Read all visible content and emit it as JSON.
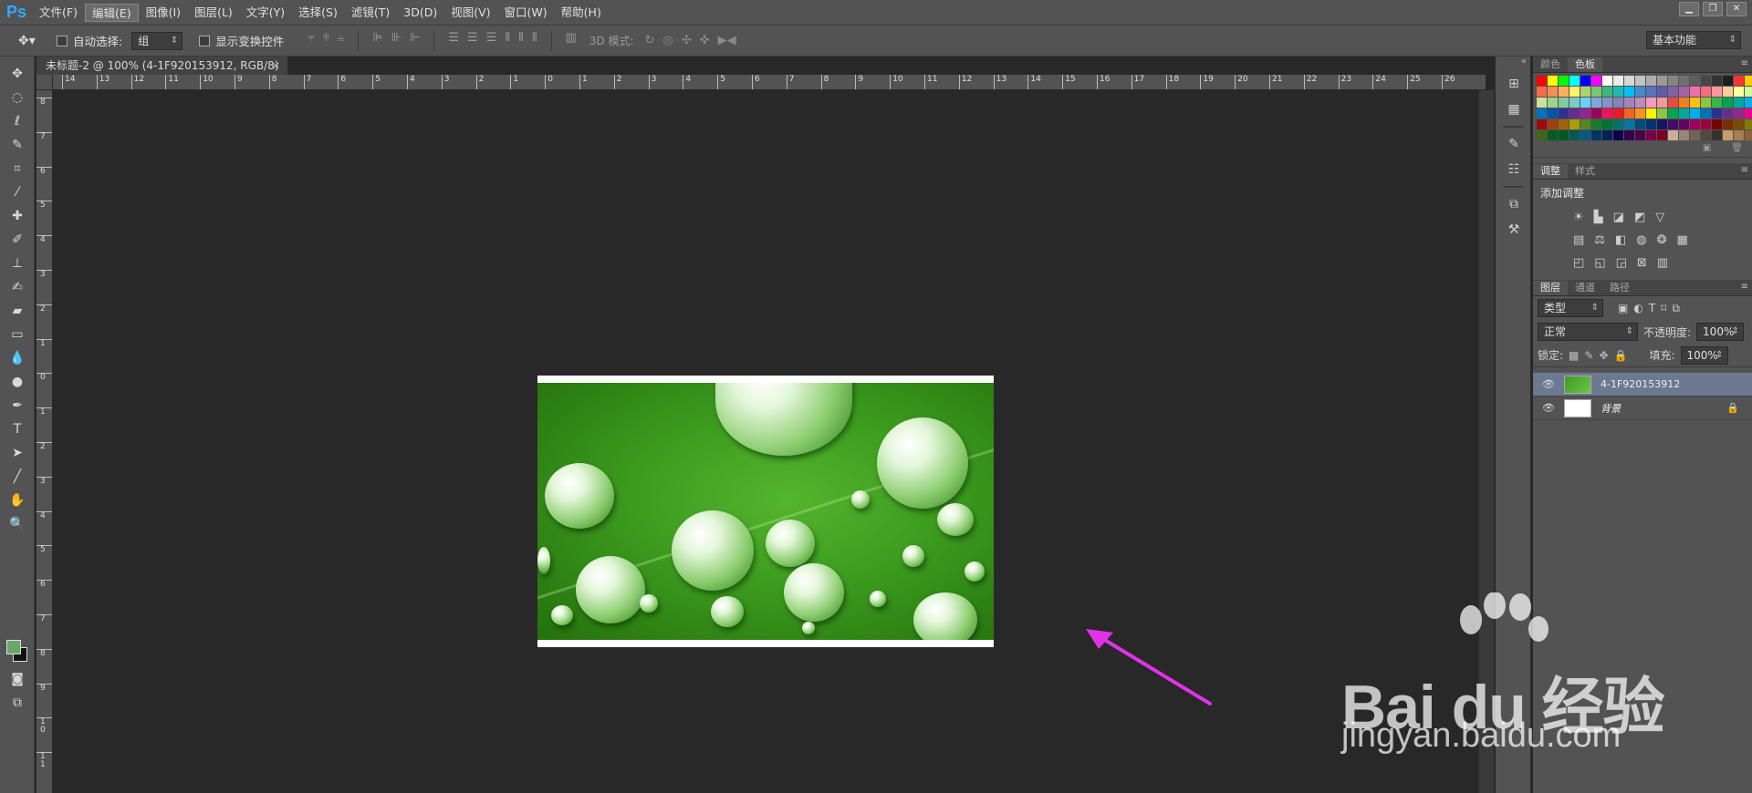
{
  "app": {
    "logo": "Ps"
  },
  "menu": [
    "文件(F)",
    "编辑(E)",
    "图像(I)",
    "图层(L)",
    "文字(Y)",
    "选择(S)",
    "滤镜(T)",
    "3D(D)",
    "视图(V)",
    "窗口(W)",
    "帮助(H)"
  ],
  "menu_active_index": 1,
  "options": {
    "auto_select_label": "自动选择:",
    "auto_select_value": "组",
    "show_transform_label": "显示变换控件",
    "mode_3d_label": "3D 模式:",
    "workspace": "基本功能"
  },
  "document": {
    "tab_title": "未标题-2 @ 100% (4-1F920153912, RGB/8) *",
    "close_glyph": "×"
  },
  "ruler_h": [
    "14",
    "13",
    "12",
    "11",
    "10",
    "9",
    "8",
    "7",
    "6",
    "5",
    "4",
    "3",
    "2",
    "1",
    "0",
    "1",
    "2",
    "3",
    "4",
    "5",
    "6",
    "7",
    "8",
    "9",
    "10",
    "11",
    "12",
    "13",
    "14",
    "15",
    "16",
    "17",
    "18",
    "19",
    "20",
    "21",
    "22",
    "23",
    "24",
    "25",
    "26"
  ],
  "ruler_v": [
    "8",
    "7",
    "6",
    "5",
    "4",
    "3",
    "2",
    "1",
    "0",
    "1",
    "2",
    "3",
    "4",
    "5",
    "6",
    "7",
    "8",
    "9",
    "1\n0",
    "1\n1"
  ],
  "panels": {
    "swatch_tabs": [
      "颜色",
      "色板"
    ],
    "adjust_tabs": [
      "调整",
      "样式"
    ],
    "adjust_title": "添加调整",
    "layer_tabs": [
      "图层",
      "通道",
      "路径"
    ],
    "filter_kind": "类型",
    "blend_mode": "正常",
    "opacity_label": "不透明度:",
    "opacity_value": "100%",
    "lock_label": "锁定:",
    "fill_label": "填充:",
    "fill_value": "100%",
    "layers": [
      {
        "name": "4-1F920153912",
        "selected": true
      },
      {
        "name": "背景",
        "selected": false,
        "locked": true
      }
    ]
  },
  "swatch_colors": [
    "#ff0000",
    "#ffff00",
    "#00ff00",
    "#00ffff",
    "#0000ff",
    "#ff00ff",
    "#ffffff",
    "#ebebeb",
    "#d6d6d6",
    "#c2c2c2",
    "#adadad",
    "#999999",
    "#858585",
    "#707070",
    "#5c5c5c",
    "#474747",
    "#333333",
    "#1f1f1f",
    "#ff3333",
    "#ffcc00",
    "#f26c4f",
    "#f68e55",
    "#fbaf5c",
    "#fff467",
    "#acd372",
    "#7cc576",
    "#3bb878",
    "#1abbb4",
    "#00bff3",
    "#438ccb",
    "#5574b9",
    "#605ca8",
    "#855fa8",
    "#a763a8",
    "#f06ea9",
    "#f26d7d",
    "#ff9999",
    "#ffcc99",
    "#ffff99",
    "#ccff99",
    "#c8e29a",
    "#9fd38a",
    "#82ca9c",
    "#7accc8",
    "#6dcff6",
    "#7da7d9",
    "#8393ca",
    "#8781bd",
    "#a186be",
    "#bd8cbf",
    "#f49ac1",
    "#f5989d",
    "#e34b4b",
    "#f07e1b",
    "#ffc20e",
    "#8dc63f",
    "#39b54a",
    "#00a651",
    "#00a99d",
    "#00aeef",
    "#0072bc",
    "#0054a6",
    "#2e3192",
    "#662d91",
    "#92278f",
    "#9e005d",
    "#ed145b",
    "#ed1c24",
    "#f26522",
    "#f7941d",
    "#fff200",
    "#8dc63f",
    "#00a651",
    "#00a99d",
    "#00aeef",
    "#0072bc",
    "#2e3192",
    "#662d91",
    "#92278f",
    "#ec008c",
    "#9e0b0f",
    "#a0410d",
    "#a36209",
    "#aba000",
    "#598527",
    "#1a7b30",
    "#007236",
    "#00746b",
    "#0076a3",
    "#004b80",
    "#003471",
    "#1b1464",
    "#440e62",
    "#630460",
    "#9e005d",
    "#9e0039",
    "#790000",
    "#7b2e00",
    "#7d4900",
    "#827b00",
    "#406618",
    "#005e20",
    "#005826",
    "#005952",
    "#005b7f",
    "#003663",
    "#002157",
    "#0d004c",
    "#32004b",
    "#4b0049",
    "#7b0046",
    "#7a0026",
    "#c7b299",
    "#998675",
    "#736357",
    "#534741",
    "#37302d",
    "#c69c6d",
    "#a67c52",
    "#8c6239"
  ]
}
